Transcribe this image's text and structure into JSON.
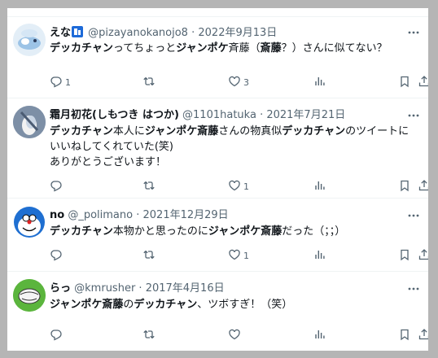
{
  "tweets": [
    {
      "name": "えな",
      "handle": "@pizayanokanojo8",
      "date": "2022年9月13日",
      "lines": [
        [
          {
            "t": "デッカチャン",
            "b": true
          },
          {
            "t": "ってちょっと",
            "b": false
          },
          {
            "t": "ジャンポケ",
            "b": true
          },
          {
            "t": "斉藤（",
            "b": false
          },
          {
            "t": "斎藤",
            "b": true
          },
          {
            "t": "？）さんに似てない？",
            "b": false
          }
        ]
      ],
      "counts": {
        "reply": "1",
        "retweet": "",
        "like": "3"
      }
    },
    {
      "name": "霜月初花(しもつき はつか)",
      "handle": "@1101hatuka",
      "date": "2021年7月21日",
      "lines": [
        [
          {
            "t": "デッカチャン",
            "b": true
          },
          {
            "t": "本人に",
            "b": false
          },
          {
            "t": "ジャンポケ斎藤",
            "b": true
          },
          {
            "t": "さんの物真似",
            "b": false
          },
          {
            "t": "デッカチャン",
            "b": true
          },
          {
            "t": "のツイートに",
            "b": false
          }
        ],
        [
          {
            "t": "いいねしてくれていた(笑)",
            "b": false
          }
        ],
        [
          {
            "t": "ありがとうございます！",
            "b": false
          }
        ]
      ],
      "counts": {
        "reply": "",
        "retweet": "",
        "like": "1"
      }
    },
    {
      "name": "no",
      "handle": "@_polimano",
      "date": "2021年12月29日",
      "lines": [
        [
          {
            "t": "デッカチャン",
            "b": true
          },
          {
            "t": "本物かと思ったのに",
            "b": false
          },
          {
            "t": "ジャンポケ斎藤",
            "b": true
          },
          {
            "t": "だった（；；）",
            "b": false
          }
        ]
      ],
      "counts": {
        "reply": "",
        "retweet": "",
        "like": "1"
      }
    },
    {
      "name": "らっ",
      "handle": "@kmrusher",
      "date": "2017年4月16日",
      "lines": [
        [
          {
            "t": "ジャンポケ斎藤",
            "b": true
          },
          {
            "t": "の",
            "b": false
          },
          {
            "t": "デッカチャン",
            "b": true
          },
          {
            "t": "、ツボすぎ！（笑）",
            "b": false
          }
        ]
      ],
      "counts": {
        "reply": "",
        "retweet": "",
        "like": ""
      }
    }
  ],
  "separator": " · ",
  "icons": [
    "more-icon",
    "reply-icon",
    "retweet-icon",
    "like-icon",
    "views-icon",
    "bookmark-icon",
    "share-icon",
    "verified-badge-icon"
  ],
  "colors": {
    "text": "#0f1419",
    "meta": "#536471",
    "border": "#eff3f4",
    "badge": "#1d6ad8"
  }
}
